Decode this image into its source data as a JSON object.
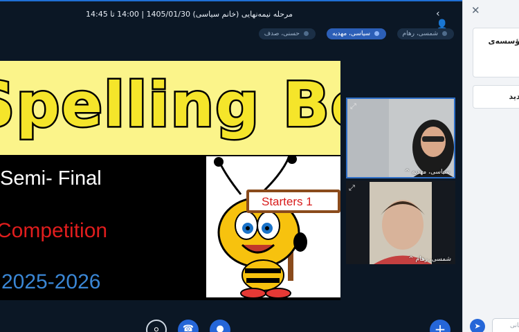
{
  "header": {
    "title": "مرحله نیمه‌نهایی (خانم سیاسی) 1405/01/30 | 14:00 تا 14:45",
    "user_icon": "user-icon"
  },
  "participants": [
    {
      "name": "شمسی، رهام",
      "talking": false
    },
    {
      "name": "سیاسی، مهدیه",
      "talking": true
    },
    {
      "name": "حسنی، صدف",
      "talking": false
    }
  ],
  "slide": {
    "banner": "Spelling Bee",
    "line1": "Semi- Final",
    "line2": "Competition",
    "line3": "2025-2026",
    "sign_text": "Starters 1",
    "colors": {
      "banner_bg": "#fbf48a",
      "banner_text": "#f5e52a",
      "competition": "#e01d1d",
      "year": "#3a86d4"
    }
  },
  "videos": [
    {
      "label": "سیاسی، مهدیه ^"
    },
    {
      "label": "شمسی، رهام ^"
    }
  ],
  "controls": {
    "camera_icon": "camera-off-icon",
    "phone_icon": "phone-icon",
    "mic_icon": "microphone-icon",
    "plus_icon": "plus-icon"
  },
  "sidebar": {
    "close_icon": "close-icon",
    "card1_text": "مؤسسه‌ی",
    "card2_text": "ردید",
    "chat_placeholder": "گانی",
    "send_icon": "send-icon"
  },
  "accent_color": "#2566d8"
}
